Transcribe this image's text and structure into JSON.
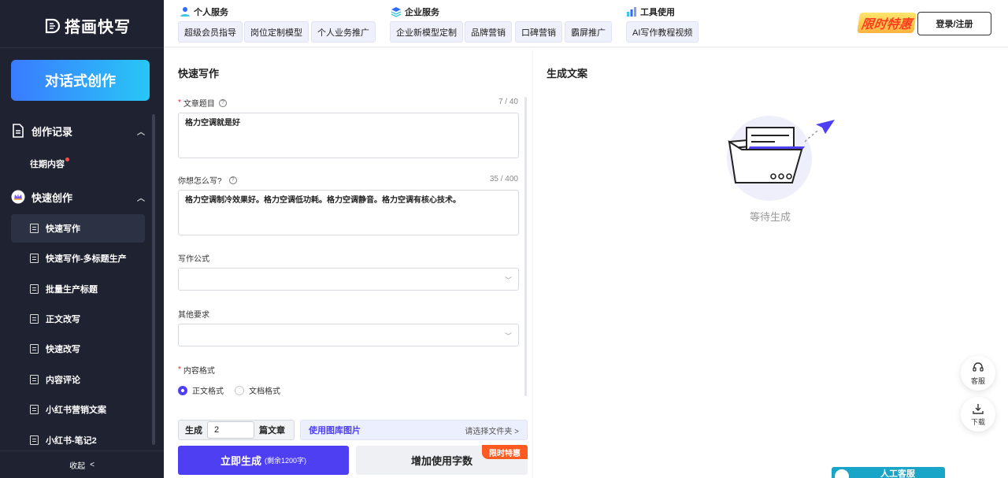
{
  "brand": {
    "name": "搭画快写"
  },
  "sidebar": {
    "cta_label": "对话式创作",
    "sections": [
      {
        "label": "创作记录",
        "children": [
          "往期内容"
        ]
      },
      {
        "label": "快速创作"
      }
    ],
    "nav_items": [
      "快速写作",
      "快速写作-多标题生产",
      "批量生产标题",
      "正文改写",
      "快速改写",
      "内容评论",
      "小红书营销文案",
      "小红书-笔记2"
    ],
    "active_index": 0,
    "collapse_label": "收起",
    "collapse_icon": "<"
  },
  "topbar": {
    "groups": [
      {
        "title": "个人服务",
        "tags": [
          "超级会员指导",
          "岗位定制模型",
          "个人业务推广"
        ]
      },
      {
        "title": "企业服务",
        "tags": [
          "企业新模型定制",
          "品牌营销",
          "口碑营销",
          "霸屏推广"
        ]
      },
      {
        "title": "工具使用",
        "tags": [
          "AI写作教程视频"
        ]
      }
    ],
    "promo_label": "限时特惠",
    "login_label": "登录/注册"
  },
  "form": {
    "title": "快速写作",
    "article_title": {
      "label": "文章题目",
      "count": "7 / 40",
      "value": "格力空调就是好"
    },
    "how_to_write": {
      "label": "你想怎么写?",
      "count": "35 / 400",
      "value": "格力空调制冷效果好。格力空调低功耗。格力空调静音。格力空调有核心技术。"
    },
    "formula": {
      "label": "写作公式",
      "value": ""
    },
    "other": {
      "label": "其他要求",
      "value": ""
    },
    "content_format": {
      "label": "内容格式",
      "options": [
        "正文格式",
        "文档格式"
      ],
      "selected": 0
    },
    "generate": {
      "prefix": "生成",
      "count": "2",
      "suffix": "篇文章"
    },
    "library": {
      "label": "使用图库图片",
      "select_label": "请选择文件夹",
      "select_icon": ">"
    },
    "submit": {
      "label": "立即生成",
      "note": "(剩余1200字)"
    },
    "add_words": {
      "label": "增加使用字数",
      "badge": "限时特惠"
    }
  },
  "output": {
    "title": "生成文案",
    "empty_text": "等待生成"
  },
  "float": {
    "service_label": "客服",
    "download_label": "下载",
    "cs_label": "人工客服"
  },
  "colors": {
    "accent": "#4e3ff2",
    "sidebar_bg": "#1e2231",
    "promo": "#ff5a1f",
    "cs": "#18a5c7"
  }
}
